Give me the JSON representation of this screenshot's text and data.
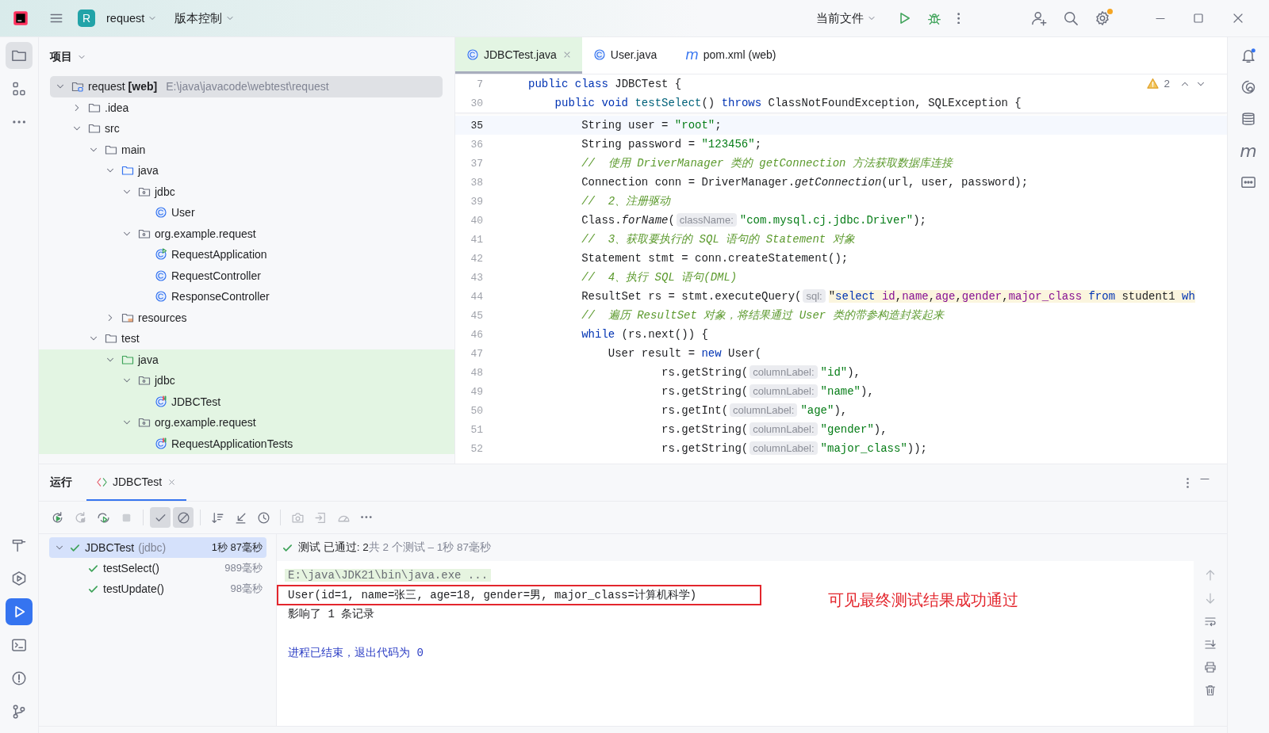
{
  "title_bar": {
    "project_badge": "R",
    "project": "request",
    "vcs": "版本控制",
    "run_config": "当前文件"
  },
  "left_tools": [
    {
      "kind": "folder",
      "selected": true
    },
    {
      "kind": "structure",
      "selected": false
    },
    {
      "kind": "more",
      "selected": false
    }
  ],
  "left_tools_bottom": [
    {
      "kind": "hammer",
      "selected": false
    },
    {
      "kind": "services",
      "selected": false
    },
    {
      "kind": "run",
      "selected": true
    },
    {
      "kind": "terminal",
      "selected": false
    },
    {
      "kind": "problems",
      "selected": false
    },
    {
      "kind": "git",
      "selected": false
    }
  ],
  "project_panel": {
    "title": "项目",
    "tree": [
      {
        "name": "request **[web]**",
        "path": "E:\\java\\javacode\\webtest\\request",
        "kind": "module",
        "selected": true,
        "expanded": true,
        "children": [
          {
            "name": ".idea",
            "kind": "folder",
            "selected": false,
            "expanded": false
          },
          {
            "name": "src",
            "kind": "folder",
            "selected": false,
            "expanded": true,
            "children": [
              {
                "name": "main",
                "kind": "folder",
                "selected": false,
                "expanded": true,
                "children": [
                  {
                    "name": "java",
                    "kind": "source",
                    "selected": false,
                    "expanded": true,
                    "children": [
                      {
                        "name": "jdbc",
                        "kind": "package",
                        "selected": false,
                        "expanded": true,
                        "children": [
                          {
                            "name": "User",
                            "kind": "class",
                            "selected": false
                          }
                        ]
                      },
                      {
                        "name": "org.example.request",
                        "kind": "package",
                        "selected": false,
                        "expanded": true,
                        "children": [
                          {
                            "name": "RequestApplication",
                            "kind": "spring",
                            "selected": false
                          },
                          {
                            "name": "RequestController",
                            "kind": "class",
                            "selected": false
                          },
                          {
                            "name": "ResponseController",
                            "kind": "class",
                            "selected": false
                          }
                        ]
                      }
                    ]
                  },
                  {
                    "name": "resources",
                    "kind": "resources",
                    "selected": false,
                    "expanded": false
                  }
                ]
              },
              {
                "name": "test",
                "kind": "folder",
                "selected": false,
                "expanded": true,
                "children": [
                  {
                    "name": "java",
                    "kind": "test_source",
                    "selected": false,
                    "expanded": true,
                    "children": [
                      {
                        "name": "jdbc",
                        "kind": "package",
                        "selected": false,
                        "expanded": true,
                        "children": [
                          {
                            "name": "JDBCTest",
                            "kind": "test_class",
                            "selected": false
                          }
                        ]
                      },
                      {
                        "name": "org.example.request",
                        "kind": "package",
                        "selected": false,
                        "expanded": true,
                        "children": [
                          {
                            "name": "RequestApplicationTests",
                            "kind": "test_class",
                            "selected": false
                          }
                        ]
                      }
                    ]
                  }
                ]
              }
            ]
          }
        ]
      }
    ]
  },
  "editor": {
    "tabs": [
      {
        "label": "JDBCTest.java",
        "kind": "class",
        "selected": true,
        "closable": true
      },
      {
        "label": "User.java",
        "kind": "class",
        "selected": false,
        "closable": false
      },
      {
        "label": "pom.xml (web)",
        "kind": "maven",
        "glyph": "m",
        "selected": false,
        "closable": false
      }
    ],
    "warning_count": "2",
    "lines": [
      {
        "no": "7",
        "sticky": true,
        "tokens": [
          {
            "kind": "keyword",
            "text": "public class"
          },
          {
            "kind": "plain",
            "text": " JDBCTest {"
          }
        ]
      },
      {
        "no": "30",
        "sticky": true,
        "tokens": [
          {
            "kind": "keyword",
            "text": "    public void"
          },
          {
            "kind": "function",
            "text": " testSelect"
          },
          {
            "kind": "plain",
            "text": "() "
          },
          {
            "kind": "keyword",
            "text": "throws"
          },
          {
            "kind": "plain",
            "text": " ClassNotFoundException, SQLException {"
          }
        ]
      },
      {
        "no": "35",
        "current": true,
        "tokens": [
          {
            "kind": "plain",
            "text": "        String user = "
          },
          {
            "kind": "string",
            "text": "\"root\""
          },
          {
            "kind": "plain",
            "text": ";"
          }
        ]
      },
      {
        "no": "36",
        "tokens": [
          {
            "kind": "plain",
            "text": "        String password = "
          },
          {
            "kind": "string",
            "text": "\"123456\""
          },
          {
            "kind": "plain",
            "text": ";"
          }
        ]
      },
      {
        "no": "37",
        "tokens": [
          {
            "kind": "comment",
            "text": "        //  使用 DriverManager 类的 getConnection 方法获取数据库连接"
          }
        ]
      },
      {
        "no": "38",
        "tokens": [
          {
            "kind": "plain",
            "text": "        Connection conn = DriverManager."
          },
          {
            "kind": "static",
            "text": "getConnection"
          },
          {
            "kind": "plain",
            "text": "(url, user, password);"
          }
        ]
      },
      {
        "no": "39",
        "tokens": [
          {
            "kind": "comment",
            "text": "        //  2、注册驱动"
          }
        ]
      },
      {
        "no": "40",
        "tokens": [
          {
            "kind": "plain",
            "text": "        Class."
          },
          {
            "kind": "static",
            "text": "forName"
          },
          {
            "kind": "plain",
            "text": "("
          },
          {
            "kind": "hint",
            "text": "className:"
          },
          {
            "kind": "string",
            "text": "\"com.mysql.cj.jdbc.Driver\""
          },
          {
            "kind": "plain",
            "text": ");"
          }
        ]
      },
      {
        "no": "41",
        "tokens": [
          {
            "kind": "comment",
            "text": "        //  3、获取要执行的 SQL 语句的 Statement 对象"
          }
        ]
      },
      {
        "no": "42",
        "tokens": [
          {
            "kind": "plain",
            "text": "        Statement stmt = conn.createStatement();"
          }
        ]
      },
      {
        "no": "43",
        "tokens": [
          {
            "kind": "comment",
            "text": "        //  4、执行 SQL 语句(DML)"
          }
        ]
      },
      {
        "no": "44",
        "tokens": [
          {
            "kind": "plain",
            "text": "        ResultSet rs = stmt.executeQuery("
          },
          {
            "kind": "hint",
            "text": "sql:"
          },
          {
            "kind": "sql",
            "text": "\""
          },
          {
            "kind": "sql_keyword",
            "text": "select"
          },
          {
            "kind": "sql_name",
            "text": " id"
          },
          {
            "kind": "sql",
            "text": ","
          },
          {
            "kind": "sql_name",
            "text": "name"
          },
          {
            "kind": "sql",
            "text": ","
          },
          {
            "kind": "sql_name",
            "text": "age"
          },
          {
            "kind": "sql",
            "text": ","
          },
          {
            "kind": "sql_name",
            "text": "gender"
          },
          {
            "kind": "sql",
            "text": ","
          },
          {
            "kind": "sql_name",
            "text": "major_class"
          },
          {
            "kind": "sql_keyword",
            "text": " from"
          },
          {
            "kind": "sql",
            "text": " student1 "
          },
          {
            "kind": "sql_keyword",
            "text": "wh"
          }
        ]
      },
      {
        "no": "45",
        "tokens": [
          {
            "kind": "comment",
            "text": "        //  遍历 ResultSet 对象，将结果通过 User 类的带参构造封装起来"
          }
        ]
      },
      {
        "no": "46",
        "tokens": [
          {
            "kind": "keyword",
            "text": "        while"
          },
          {
            "kind": "plain",
            "text": " (rs.next()) {"
          }
        ]
      },
      {
        "no": "47",
        "tokens": [
          {
            "kind": "plain",
            "text": "            User result = "
          },
          {
            "kind": "keyword",
            "text": "new"
          },
          {
            "kind": "plain",
            "text": " User("
          }
        ]
      },
      {
        "no": "48",
        "tokens": [
          {
            "kind": "plain",
            "text": "                    rs.getString("
          },
          {
            "kind": "hint",
            "text": "columnLabel:"
          },
          {
            "kind": "string",
            "text": "\"id\""
          },
          {
            "kind": "plain",
            "text": "),"
          }
        ]
      },
      {
        "no": "49",
        "tokens": [
          {
            "kind": "plain",
            "text": "                    rs.getString("
          },
          {
            "kind": "hint",
            "text": "columnLabel:"
          },
          {
            "kind": "string",
            "text": "\"name\""
          },
          {
            "kind": "plain",
            "text": "),"
          }
        ]
      },
      {
        "no": "50",
        "tokens": [
          {
            "kind": "plain",
            "text": "                    rs.getInt("
          },
          {
            "kind": "hint",
            "text": "columnLabel:"
          },
          {
            "kind": "string",
            "text": "\"age\""
          },
          {
            "kind": "plain",
            "text": "),"
          }
        ]
      },
      {
        "no": "51",
        "tokens": [
          {
            "kind": "plain",
            "text": "                    rs.getString("
          },
          {
            "kind": "hint",
            "text": "columnLabel:"
          },
          {
            "kind": "string",
            "text": "\"gender\""
          },
          {
            "kind": "plain",
            "text": "),"
          }
        ]
      },
      {
        "no": "52",
        "tokens": [
          {
            "kind": "plain",
            "text": "                    rs.getString("
          },
          {
            "kind": "hint",
            "text": "columnLabel:"
          },
          {
            "kind": "string",
            "text": "\"major_class\""
          },
          {
            "kind": "plain",
            "text": "));"
          }
        ]
      }
    ]
  },
  "right_tools": [
    {
      "kind": "bell"
    },
    {
      "kind": "spiral"
    },
    {
      "kind": "database"
    },
    {
      "kind": "maven",
      "glyph": "m"
    },
    {
      "kind": "message"
    }
  ],
  "run_panel": {
    "title": "运行",
    "tabs": [
      {
        "label": "JDBCTest",
        "selected": true
      }
    ],
    "toolbar": [
      {
        "kind": "rerun",
        "on": false,
        "disabled": false
      },
      {
        "kind": "rerun_failed",
        "on": false,
        "disabled": true
      },
      {
        "kind": "rerun_auto",
        "on": false,
        "disabled": false
      },
      {
        "kind": "stop",
        "on": false,
        "disabled": true
      },
      {
        "kind": "separator"
      },
      {
        "kind": "show_passed",
        "on": true,
        "disabled": false
      },
      {
        "kind": "show_ignored",
        "on": true,
        "disabled": false
      },
      {
        "kind": "separator"
      },
      {
        "kind": "sort",
        "on": false,
        "disabled": false
      },
      {
        "kind": "collapse",
        "on": false,
        "disabled": false
      },
      {
        "kind": "history",
        "on": false,
        "disabled": false
      },
      {
        "kind": "separator"
      },
      {
        "kind": "camera",
        "on": false,
        "disabled": true
      },
      {
        "kind": "import",
        "on": false,
        "disabled": true
      },
      {
        "kind": "coverage",
        "on": false,
        "disabled": true
      },
      {
        "kind": "more",
        "on": false,
        "disabled": false
      }
    ],
    "tests": [
      {
        "name": "JDBCTest",
        "package": "(jdbc)",
        "time": "1秒 87毫秒",
        "passed": true,
        "selected": true,
        "expanded": true,
        "children": [
          {
            "name": "testSelect()",
            "time": "989毫秒",
            "passed": true,
            "selected": false
          },
          {
            "name": "testUpdate()",
            "time": "98毫秒",
            "passed": true,
            "selected": false
          }
        ]
      }
    ],
    "status_passed": "测试 已通过: 2",
    "status_detail": "共 2 个测试 – 1秒 87毫秒",
    "console": [
      {
        "kind": "command",
        "text": "E:\\java\\JDK21\\bin\\java.exe ...",
        "boxed": false
      },
      {
        "kind": "output",
        "text": "User(id=1, name=张三, age=18, gender=男, major_class=计算机科学)",
        "boxed": true
      },
      {
        "kind": "output",
        "text": "影响了 1 条记录",
        "boxed": false
      },
      {
        "kind": "exit",
        "text": "进程已结束，退出代码为 0",
        "boxed": false
      }
    ],
    "annotation": "可见最终测试结果成功通过"
  }
}
